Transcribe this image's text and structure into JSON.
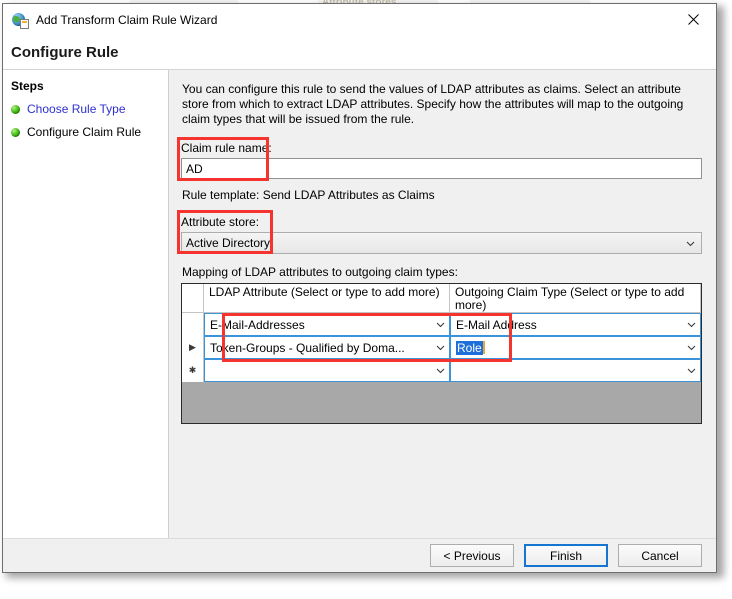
{
  "background": {
    "strip_labels": [
      "Attribute stores"
    ]
  },
  "window": {
    "title": "Add Transform Claim Rule Wizard",
    "icon": "adfs-claim-rule-icon",
    "close_label": "✕",
    "header_title": "Configure Rule"
  },
  "sidebar": {
    "title": "Steps",
    "items": [
      {
        "label": "Choose Rule Type",
        "is_link": true,
        "bullet": "green-bullet-icon"
      },
      {
        "label": "Configure Claim Rule",
        "is_link": false,
        "bullet": "green-bullet-icon"
      }
    ]
  },
  "content": {
    "intro": "You can configure this rule to send the values of LDAP attributes as claims. Select an attribute store from which to extract LDAP attributes. Specify how the attributes will map to the outgoing claim types that will be issued from the rule.",
    "claim_rule_name_label": "Claim rule name:",
    "claim_rule_name_value": "AD",
    "rule_template": "Rule template: Send LDAP Attributes as Claims",
    "attribute_store_label": "Attribute store:",
    "attribute_store_value": "Active Directory",
    "mapping_label": "Mapping of LDAP attributes to outgoing claim types:"
  },
  "grid": {
    "columns": [
      "LDAP Attribute (Select or type to add more)",
      "Outgoing Claim Type (Select or type to add more)"
    ],
    "rows": [
      {
        "indicator": "",
        "ldap_attribute": "E-Mail-Addresses",
        "outgoing_claim_type": "E-Mail Address",
        "claim_selected": false
      },
      {
        "indicator": "▶",
        "ldap_attribute": "Token-Groups - Qualified by Doma...",
        "outgoing_claim_type": "Role",
        "claim_selected": true
      },
      {
        "indicator": "✱",
        "ldap_attribute": "",
        "outgoing_claim_type": "",
        "claim_selected": false
      }
    ]
  },
  "footer": {
    "previous_label": "< Previous",
    "finish_label": "Finish",
    "cancel_label": "Cancel"
  },
  "annotations": {
    "highlight_color": "#F5332F",
    "boxes": [
      {
        "name": "claim-rule-name-highlight"
      },
      {
        "name": "attribute-store-highlight"
      },
      {
        "name": "mapping-rows-highlight"
      }
    ]
  }
}
